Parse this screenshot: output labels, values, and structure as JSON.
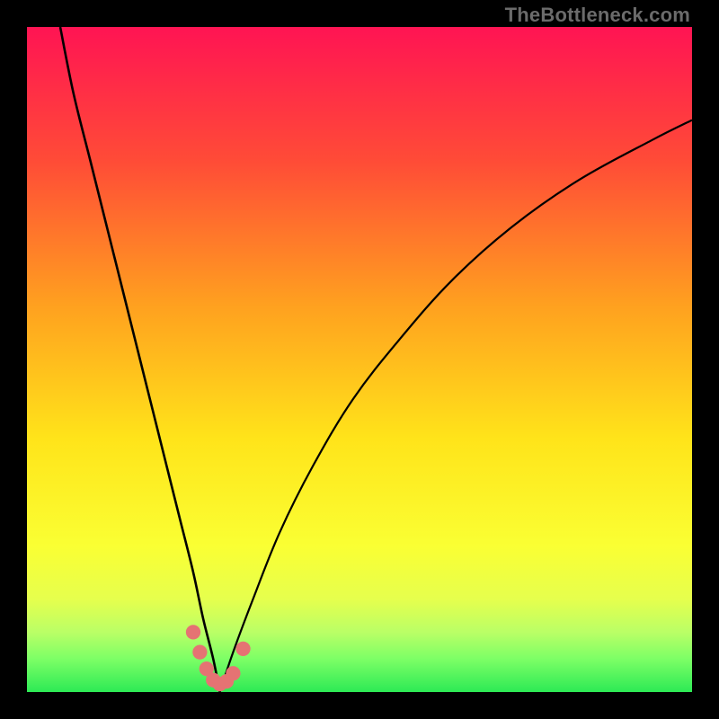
{
  "watermark": "TheBottleneck.com",
  "chart_data": {
    "type": "line",
    "title": "",
    "xlabel": "",
    "ylabel": "",
    "xlim": [
      0,
      100
    ],
    "ylim": [
      0,
      100
    ],
    "grid": false,
    "legend": false,
    "notes": "Background is a vertical red→green gradient. Two black curves descend from top toward a common minimum near x≈29, y≈0, and a cluster of salmon markers sits in the green band around that minimum.",
    "gradient_stops": [
      {
        "offset": 0.0,
        "color": "#ff1453"
      },
      {
        "offset": 0.2,
        "color": "#ff4b37"
      },
      {
        "offset": 0.42,
        "color": "#ffa11f"
      },
      {
        "offset": 0.62,
        "color": "#ffe41a"
      },
      {
        "offset": 0.78,
        "color": "#faff33"
      },
      {
        "offset": 0.86,
        "color": "#e6ff4d"
      },
      {
        "offset": 0.91,
        "color": "#baff66"
      },
      {
        "offset": 0.95,
        "color": "#7dff66"
      },
      {
        "offset": 1.0,
        "color": "#2dea55"
      }
    ],
    "series": [
      {
        "name": "left-curve",
        "x": [
          5.0,
          7.0,
          9.5,
          12.0,
          14.5,
          17.0,
          19.0,
          21.0,
          23.0,
          25.0,
          26.5,
          28.0,
          29.0
        ],
        "y": [
          100,
          90,
          80,
          70,
          60,
          50,
          42,
          34,
          26,
          18,
          11,
          5,
          0
        ]
      },
      {
        "name": "right-curve",
        "x": [
          29.0,
          31.0,
          34.0,
          38.0,
          43.0,
          49.0,
          56.0,
          64.0,
          73.0,
          83.0,
          94.0,
          100.0
        ],
        "y": [
          0,
          6,
          14,
          24,
          34,
          44,
          53,
          62,
          70,
          77,
          83,
          86
        ]
      }
    ],
    "markers": {
      "name": "bottleneck-points",
      "color": "#e57373",
      "points": [
        {
          "x": 25.0,
          "y": 9.0
        },
        {
          "x": 26.0,
          "y": 6.0
        },
        {
          "x": 27.0,
          "y": 3.5
        },
        {
          "x": 28.0,
          "y": 1.8
        },
        {
          "x": 29.0,
          "y": 1.2
        },
        {
          "x": 30.0,
          "y": 1.6
        },
        {
          "x": 31.0,
          "y": 2.8
        },
        {
          "x": 32.5,
          "y": 6.5
        }
      ]
    }
  }
}
